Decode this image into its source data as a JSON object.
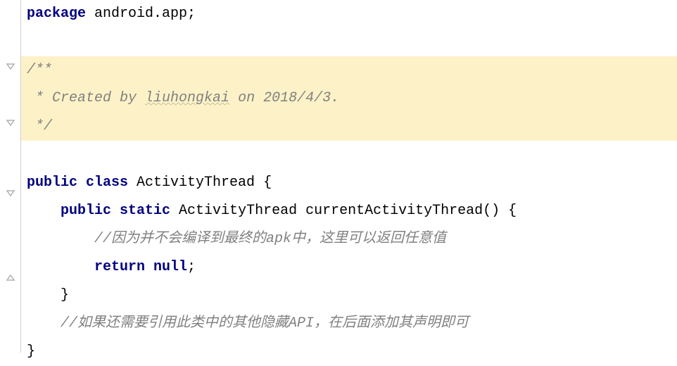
{
  "code": {
    "line1": {
      "kw_package": "package",
      "pkg_name": " android.app",
      "semicolon": ";"
    },
    "line3": {
      "comment_open": "/**"
    },
    "line4": {
      "comment_prefix": " * Created by ",
      "author": "liuhongkai",
      "comment_suffix": " on 2018/4/3."
    },
    "line5": {
      "comment_close": " */"
    },
    "line7": {
      "kw_public": "public",
      "kw_class": " class",
      "class_name": " ActivityThread ",
      "brace": "{"
    },
    "line8": {
      "indent": "    ",
      "kw_public": "public",
      "kw_static": " static",
      "return_type": " ActivityThread ",
      "method_name": "currentActivityThread",
      "parens_brace": "() {"
    },
    "line9": {
      "indent": "        ",
      "comment": "//因为并不会编译到最终的apk中，这里可以返回任意值"
    },
    "line10": {
      "indent": "        ",
      "kw_return": "return",
      "kw_null": " null",
      "semicolon": ";"
    },
    "line11": {
      "indent": "    ",
      "brace": "}"
    },
    "line12": {
      "indent": "    ",
      "comment": "//如果还需要引用此类中的其他隐藏API，在后面添加其声明即可"
    },
    "line13": {
      "brace": "}"
    }
  }
}
